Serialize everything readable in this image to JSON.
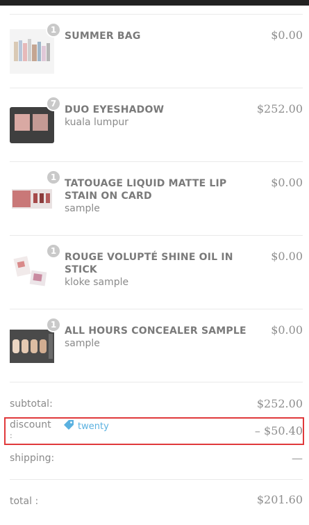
{
  "items": [
    {
      "name": "SUMMER BAG",
      "variant": "",
      "qty": "1",
      "price": "$0.00"
    },
    {
      "name": "DUO EYESHADOW",
      "variant": "kuala lumpur",
      "qty": "7",
      "price": "$252.00"
    },
    {
      "name": "TATOUAGE LIQUID MATTE LIP STAIN ON CARD",
      "variant": "sample",
      "qty": "1",
      "price": "$0.00"
    },
    {
      "name": "ROUGE VOLUPTÉ SHINE OIL IN STICK",
      "variant": "kloke sample",
      "qty": "1",
      "price": "$0.00"
    },
    {
      "name": "ALL HOURS CONCEALER SAMPLE",
      "variant": "sample",
      "qty": "1",
      "price": "$0.00"
    }
  ],
  "summary": {
    "subtotal_label": "subtotal:",
    "subtotal_value": "$252.00",
    "discount_label_line1": "discount",
    "discount_label_line2": ":",
    "discount_code": "twenty",
    "discount_value": "– $50.40",
    "shipping_label": "shipping:",
    "shipping_value": "—",
    "total_label": "total :",
    "total_value": "$201.60"
  },
  "colors": {
    "highlight": "#e0393b",
    "tag": "#5ab1e0"
  },
  "icons": {
    "discount": "tag-icon"
  }
}
